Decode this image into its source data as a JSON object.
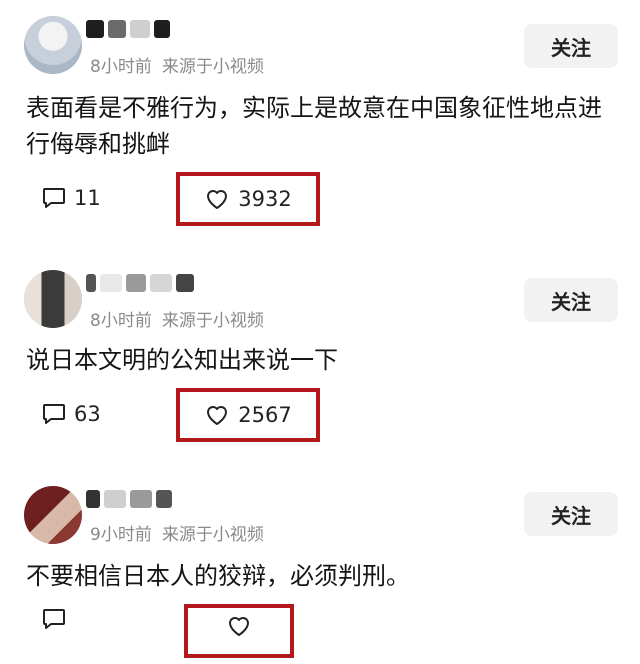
{
  "colors": {
    "highlight": "#b5181c",
    "meta_gray": "#8a8a8a",
    "follow_bg": "#f2f2f2"
  },
  "posts": [
    {
      "username": "",
      "time": "8小时前",
      "source": "来源于小视频",
      "follow_label": "关注",
      "text": "表面看是不雅行为，实际上是故意在中国象征性地点进行侮辱和挑衅",
      "comment_count": "11",
      "like_count": "3932",
      "comment_icon": "comment-icon",
      "like_icon": "heart-icon"
    },
    {
      "username": "",
      "time": "8小时前",
      "source": "来源于小视频",
      "follow_label": "关注",
      "text": "说日本文明的公知出来说一下",
      "comment_count": "63",
      "like_count": "2567",
      "comment_icon": "comment-icon",
      "like_icon": "heart-icon"
    },
    {
      "username": "",
      "time": "9小时前",
      "source": "来源于小视频",
      "follow_label": "关注",
      "text": "不要相信日本人的狡辩，必须判刑。",
      "comment_icon": "comment-icon",
      "like_icon": "heart-icon"
    }
  ]
}
